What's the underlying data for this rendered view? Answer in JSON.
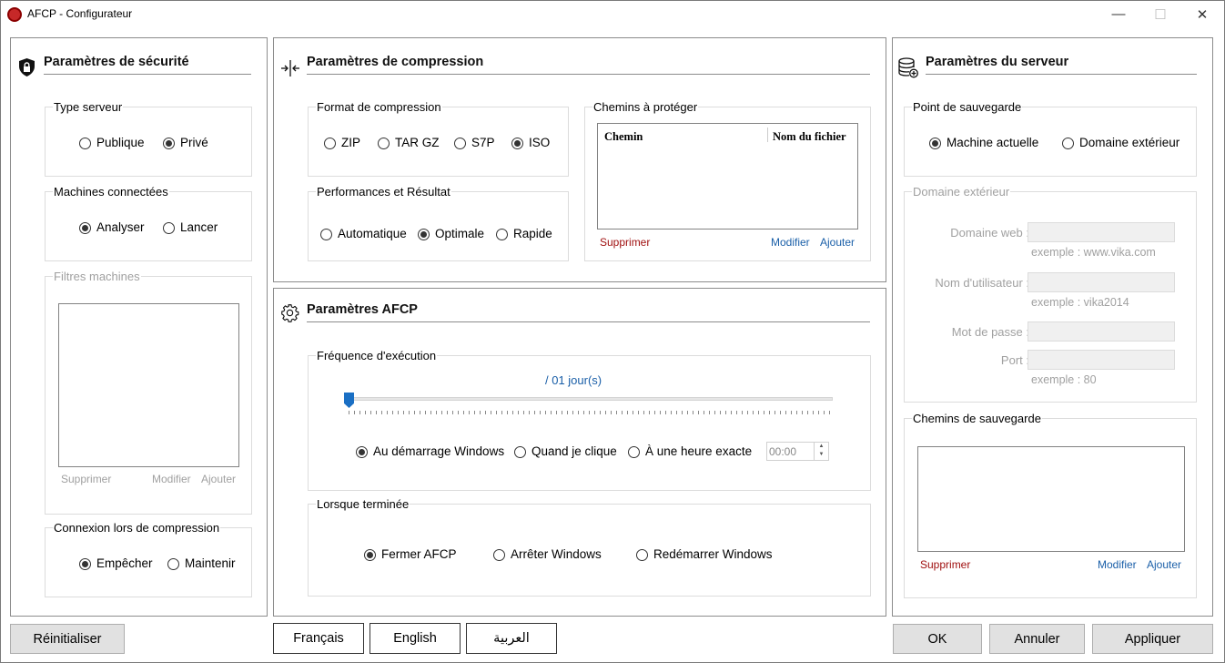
{
  "window": {
    "title": "AFCP - Configurateur",
    "controls": {
      "minimize": "—",
      "maximize": "☐",
      "close": "✕"
    }
  },
  "security": {
    "title": "Paramètres de sécurité",
    "server_type": {
      "label": "Type serveur",
      "options": [
        "Publique",
        "Privé"
      ],
      "selected": "Privé"
    },
    "connected_machines": {
      "label": "Machines connectées",
      "options": [
        "Analyser",
        "Lancer"
      ],
      "selected": "Analyser"
    },
    "machine_filters": {
      "label": "Filtres machines",
      "remove": "Supprimer",
      "edit": "Modifier",
      "add": "Ajouter"
    },
    "connection_during_compression": {
      "label": "Connexion lors de compression",
      "options": [
        "Empêcher",
        "Maintenir"
      ],
      "selected": "Empêcher"
    }
  },
  "compression": {
    "title": "Paramètres de compression",
    "format": {
      "label": "Format de compression",
      "options": [
        "ZIP",
        "TAR GZ",
        "S7P",
        "ISO"
      ],
      "selected": "ISO"
    },
    "performance": {
      "label": "Performances et Résultat",
      "options": [
        "Automatique",
        "Optimale",
        "Rapide"
      ],
      "selected": "Optimale"
    },
    "paths": {
      "label": "Chemins à protéger",
      "columns": [
        "Chemin",
        "Nom du fichier"
      ],
      "remove": "Supprimer",
      "edit": "Modifier",
      "add": "Ajouter"
    }
  },
  "afcp": {
    "title": "Paramètres AFCP",
    "frequency": {
      "label": "Fréquence d'exécution",
      "value_text": "/ 01 jour(s)",
      "slider_fraction": 0.0,
      "options": [
        "Au démarrage Windows",
        "Quand je clique",
        "À une heure exacte"
      ],
      "selected": "Au démarrage Windows",
      "time": "00:00"
    },
    "when_done": {
      "label": "Lorsque terminée",
      "options": [
        "Fermer AFCP",
        "Arrêter Windows",
        "Redémarrer Windows"
      ],
      "selected": "Fermer AFCP"
    }
  },
  "server": {
    "title": "Paramètres du serveur",
    "backup_point": {
      "label": "Point de sauvegarde",
      "options": [
        "Machine actuelle",
        "Domaine extérieur"
      ],
      "selected": "Machine actuelle"
    },
    "external_domain": {
      "label": "Domaine extérieur",
      "web_domain": "Domaine web :",
      "web_domain_hint": "exemple : www.vika.com",
      "username": "Nom d'utilisateur :",
      "username_hint": "exemple : vika2014",
      "password": "Mot de passe :",
      "port": "Port :",
      "port_hint": "exemple : 80"
    },
    "backup_paths": {
      "label": "Chemins de sauvegarde",
      "remove": "Supprimer",
      "edit": "Modifier",
      "add": "Ajouter"
    }
  },
  "footer": {
    "reset": "Réinitialiser",
    "languages": [
      "Français",
      "English",
      "العربية"
    ],
    "ok": "OK",
    "cancel": "Annuler",
    "apply": "Appliquer"
  },
  "colors": {
    "accent": "#1a6fc4",
    "link_blue": "#1a5fa8",
    "link_red": "#a01010",
    "disabled": "#a0a0a0"
  }
}
